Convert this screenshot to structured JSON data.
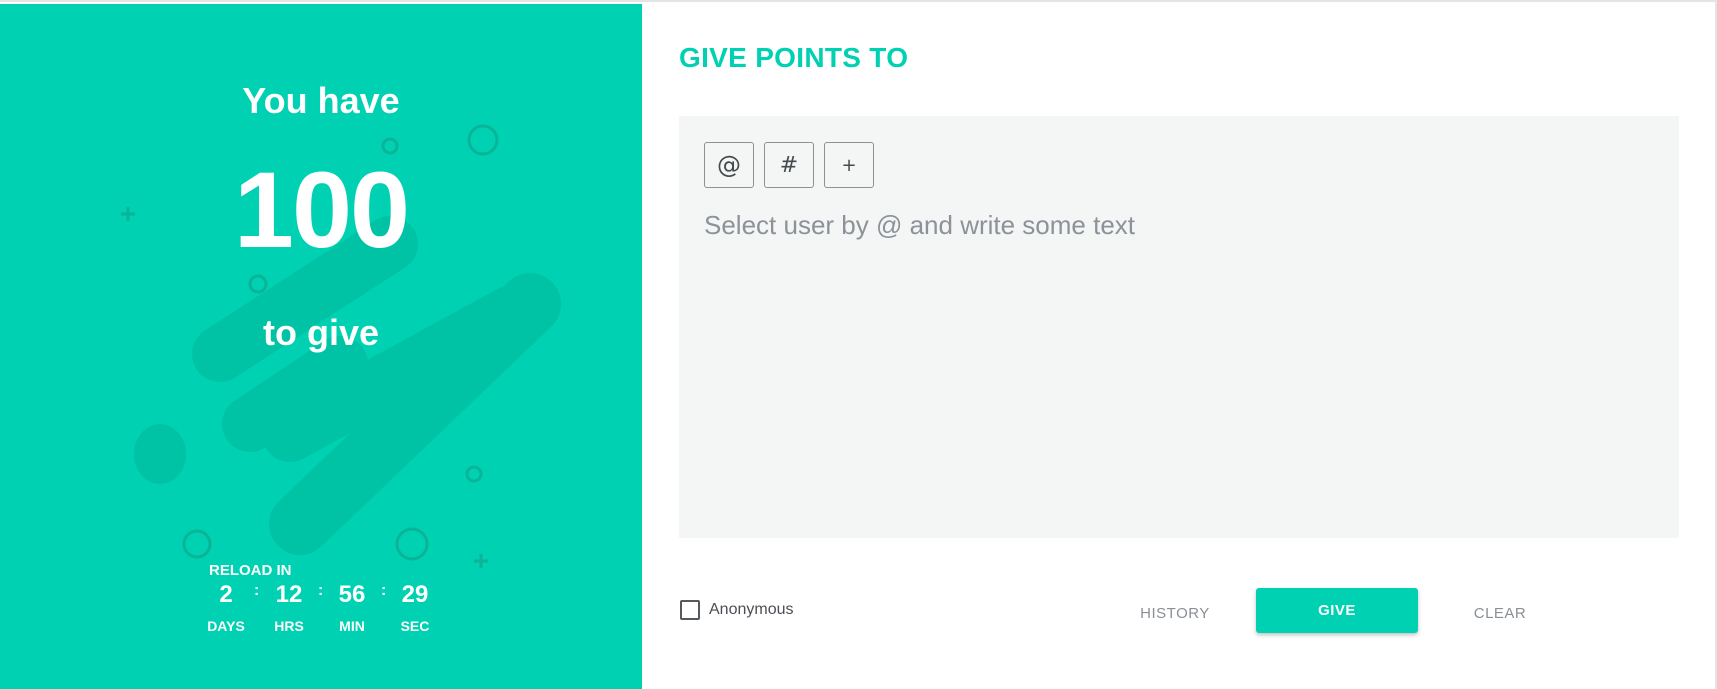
{
  "accent_color": "#00d1b2",
  "points_panel": {
    "heading": "You have",
    "points": "100",
    "subheading": "to give",
    "reload_label": "RELOAD IN",
    "countdown": [
      {
        "value": "2",
        "label": "DAYS"
      },
      {
        "value": "12",
        "label": "HRS"
      },
      {
        "value": "56",
        "label": "MIN"
      },
      {
        "value": "29",
        "label": "SEC"
      }
    ],
    "separator": ":"
  },
  "give_form": {
    "title": "GIVE POINTS TO",
    "toolbar": {
      "mention_label": "@",
      "hashtag_label": "#",
      "add_label": "+"
    },
    "message": {
      "value": "",
      "placeholder": "Select user by @ and write some text"
    },
    "anonymous": {
      "label": "Anonymous",
      "checked": false
    },
    "actions": {
      "history_label": "HISTORY",
      "give_label": "GIVE",
      "clear_label": "CLEAR"
    }
  }
}
